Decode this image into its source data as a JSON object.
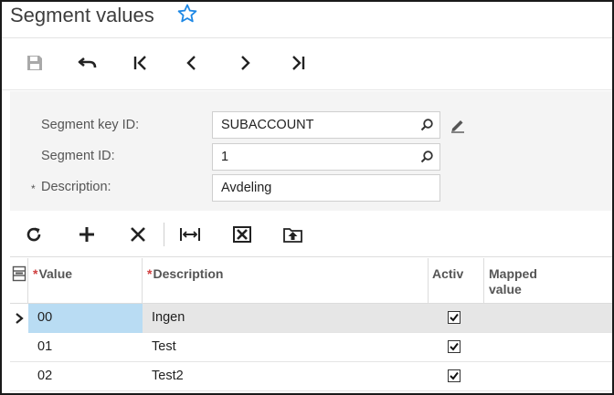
{
  "page": {
    "title": "Segment values"
  },
  "form": {
    "segment_key_label": "Segment key ID:",
    "segment_key_value": "SUBACCOUNT",
    "segment_id_label": "Segment ID:",
    "segment_id_value": "1",
    "description_required": "*",
    "description_label": "Description:",
    "description_value": "Avdeling"
  },
  "grid": {
    "columns": {
      "value": "Value",
      "description": "Description",
      "active": "Activ",
      "mapped_value_line1": "Mapped",
      "mapped_value_line2": "value"
    },
    "required_mark": "*",
    "rows": [
      {
        "value": "00",
        "description": "Ingen",
        "active": true
      },
      {
        "value": "01",
        "description": "Test",
        "active": true
      },
      {
        "value": "02",
        "description": "Test2",
        "active": true
      }
    ]
  },
  "colors": {
    "accent": "#1e88e5",
    "selected_cell": "#b9dcf3",
    "selected_row": "#e6e6e6",
    "required": "#d04040"
  }
}
